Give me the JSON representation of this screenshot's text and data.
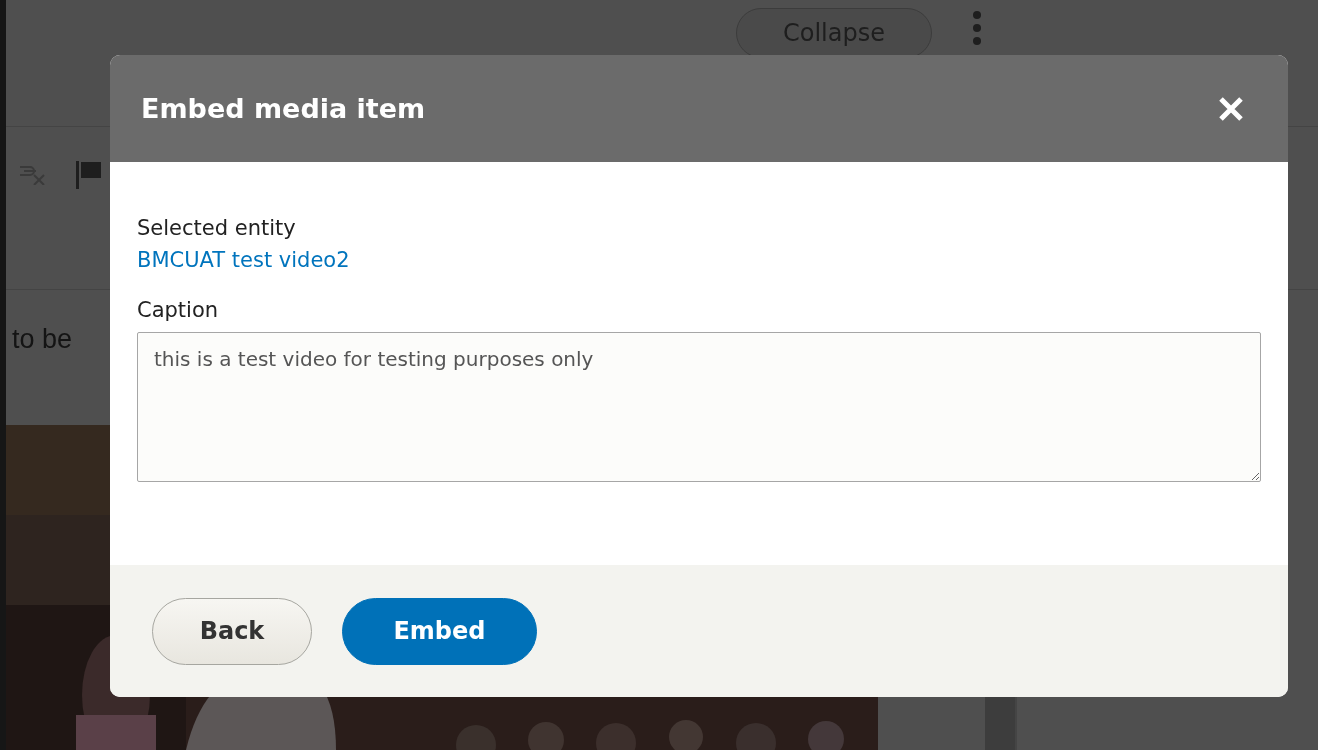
{
  "background": {
    "collapse_button": "Collapse",
    "editor_text": "to be"
  },
  "dialog": {
    "title": "Embed media item",
    "selected_label": "Selected entity",
    "selected_link": "BMCUAT test video2",
    "caption_label": "Caption",
    "caption_value": "this is a test video for testing purposes only",
    "buttons": [
      {
        "label": "Back",
        "kind": "secondary"
      },
      {
        "label": "Embed",
        "kind": "primary"
      }
    ]
  }
}
